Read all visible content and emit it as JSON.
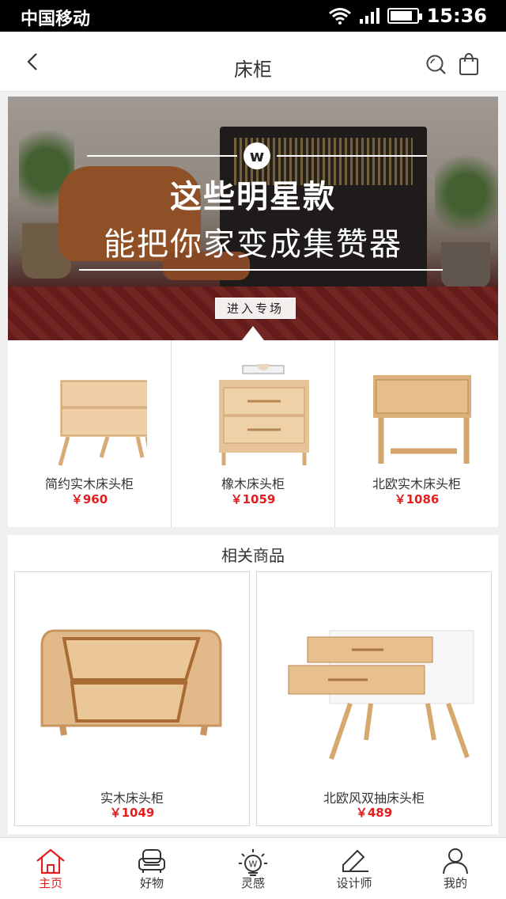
{
  "status_bar": {
    "carrier": "中国移动",
    "time": "15:36",
    "battery_level": 0.85,
    "signal_bars": 4
  },
  "nav": {
    "title": "床柜",
    "back_icon": "chevron-left-icon",
    "search_icon": "search-icon",
    "cart_icon": "shopping-bag-icon"
  },
  "banner": {
    "logo": "w",
    "headline_1": "这些明星款",
    "headline_2": "能把你家变成集赞器",
    "cta": "进入专场"
  },
  "featured": [
    {
      "name": "简约实木床头柜",
      "price": "￥960"
    },
    {
      "name": "橡木床头柜",
      "price": "￥1059"
    },
    {
      "name": "北欧实木床头柜",
      "price": "￥1086"
    }
  ],
  "related": {
    "heading": "相关商品",
    "items": [
      {
        "name": "实木床头柜",
        "price": "￥1049"
      },
      {
        "name": "北欧风双抽床头柜",
        "price": "￥489"
      }
    ]
  },
  "tabbar": {
    "active_color": "#e02020",
    "items": [
      {
        "label": "主页",
        "icon": "home-icon",
        "active": true
      },
      {
        "label": "好物",
        "icon": "armchair-icon",
        "active": false
      },
      {
        "label": "灵感",
        "icon": "lightbulb-icon",
        "active": false
      },
      {
        "label": "设计师",
        "icon": "pencil-icon",
        "active": false
      },
      {
        "label": "我的",
        "icon": "user-icon",
        "active": false
      }
    ]
  }
}
